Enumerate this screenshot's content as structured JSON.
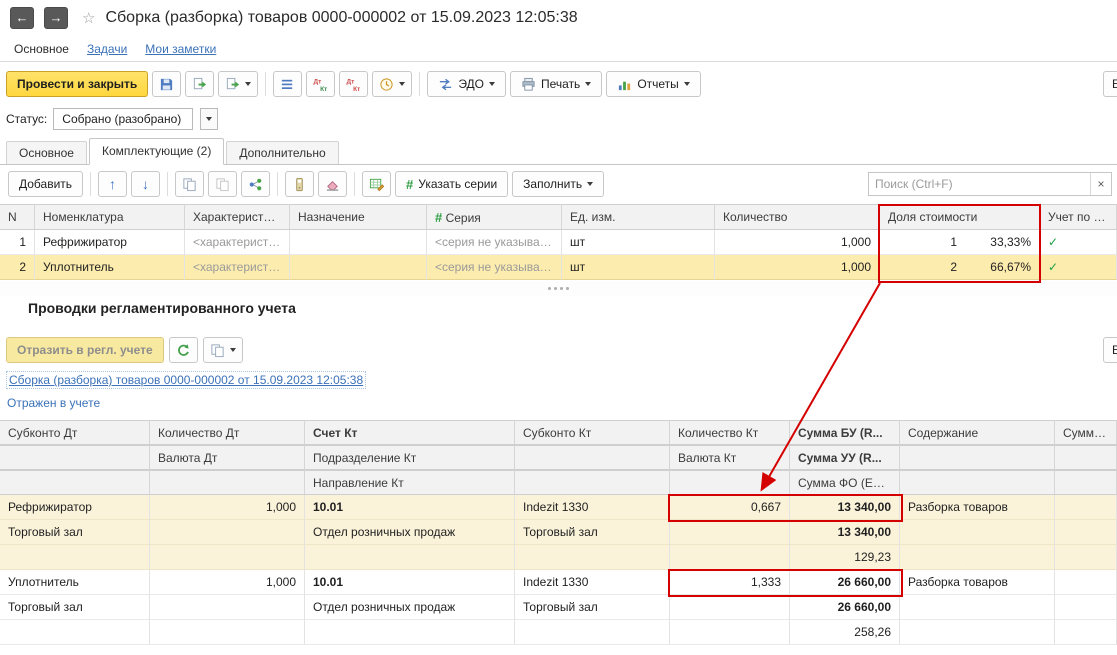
{
  "header": {
    "title": "Сборка (разборка) товаров 0000-000002 от 15.09.2023 12:05:38"
  },
  "icons": {
    "back": "←",
    "forward": "→",
    "star": "☆",
    "up": "↑",
    "down": "↓",
    "close": "×",
    "series_hash": "#"
  },
  "nav": {
    "main": "Основное",
    "tasks": "Задачи",
    "notes": "Мои заметки"
  },
  "toolbar": {
    "post_and_close": "Провести и закрыть",
    "edo": "ЭДО",
    "print": "Печать",
    "reports": "Отчеты",
    "more": "Е"
  },
  "status": {
    "label": "Статус:",
    "value": "Собрано (разобрано)"
  },
  "tabs": {
    "main": "Основное",
    "components": "Комплектующие (2)",
    "additional": "Дополнительно"
  },
  "components": {
    "add": "Добавить",
    "specify_series": "Указать серии",
    "fill": "Заполнить",
    "search_placeholder": "Поиск (Ctrl+F)",
    "headers": {
      "n": "N",
      "nomenclature": "Номенклатура",
      "characteristic": "Характеристика",
      "purpose": "Назначение",
      "series": "Серия",
      "unit": "Ед. изм.",
      "quantity": "Количество",
      "cost_share": "Доля стоимости",
      "gtd": "Учет по ГТД"
    },
    "rows": [
      {
        "n": "1",
        "nomenclature": "Рефрижиратор",
        "characteristic": "<характеристики...",
        "purpose": "",
        "series": "<серия не указывае...",
        "unit": "шт",
        "quantity": "1,000",
        "share": "1",
        "share_pct": "33,33%",
        "gtd_check": "✓"
      },
      {
        "n": "2",
        "nomenclature": "Уплотнитель",
        "characteristic": "<характеристики...",
        "purpose": "",
        "series": "<серия не указывае...",
        "unit": "шт",
        "quantity": "1,000",
        "share": "2",
        "share_pct": "66,67%",
        "gtd_check": "✓"
      }
    ]
  },
  "postings": {
    "title": "Проводки регламентированного учета",
    "reflect": "Отразить в регл. учете",
    "more": "Е",
    "doc_link": "Сборка (разборка) товаров 0000-000002 от 15.09.2023 12:05:38",
    "reflected": "Отражен в учете",
    "head1": [
      "Субконто Дт",
      "Количество Дт",
      "Счет Кт",
      "Субконто Кт",
      "Количество Кт",
      "Сумма БУ (R...",
      "Содержание",
      "Сумма Н"
    ],
    "head2": [
      "",
      "Валюта Дт",
      "Подразделение Кт",
      "",
      "Валюта Кт",
      "Сумма УУ (R...",
      "",
      ""
    ],
    "head3": [
      "",
      "",
      "Направление Кт",
      "",
      "",
      "Сумма ФО (EUR)",
      "",
      ""
    ],
    "rows": [
      [
        "Рефрижиратор",
        "1,000",
        "10.01",
        "Indezit 1330",
        "0,667",
        "13 340,00",
        "Разборка товаров",
        ""
      ],
      [
        "Торговый зал",
        "",
        "Отдел розничных продаж",
        "Торговый зал",
        "",
        "13 340,00",
        "",
        ""
      ],
      [
        "",
        "",
        "",
        "",
        "",
        "129,23",
        "",
        ""
      ],
      [
        "Уплотнитель",
        "1,000",
        "10.01",
        "Indezit 1330",
        "1,333",
        "26 660,00",
        "Разборка товаров",
        ""
      ],
      [
        "Торговый зал",
        "",
        "Отдел розничных продаж",
        "Торговый зал",
        "",
        "26 660,00",
        "",
        ""
      ],
      [
        "",
        "",
        "",
        "",
        "",
        "258,26",
        "",
        ""
      ]
    ]
  },
  "colors": {
    "annotation": "#d40000",
    "selection": "#fcecae",
    "accent_yellow": "#ffd73e",
    "link": "#3b72b8",
    "check_green": "#1d9e42"
  }
}
